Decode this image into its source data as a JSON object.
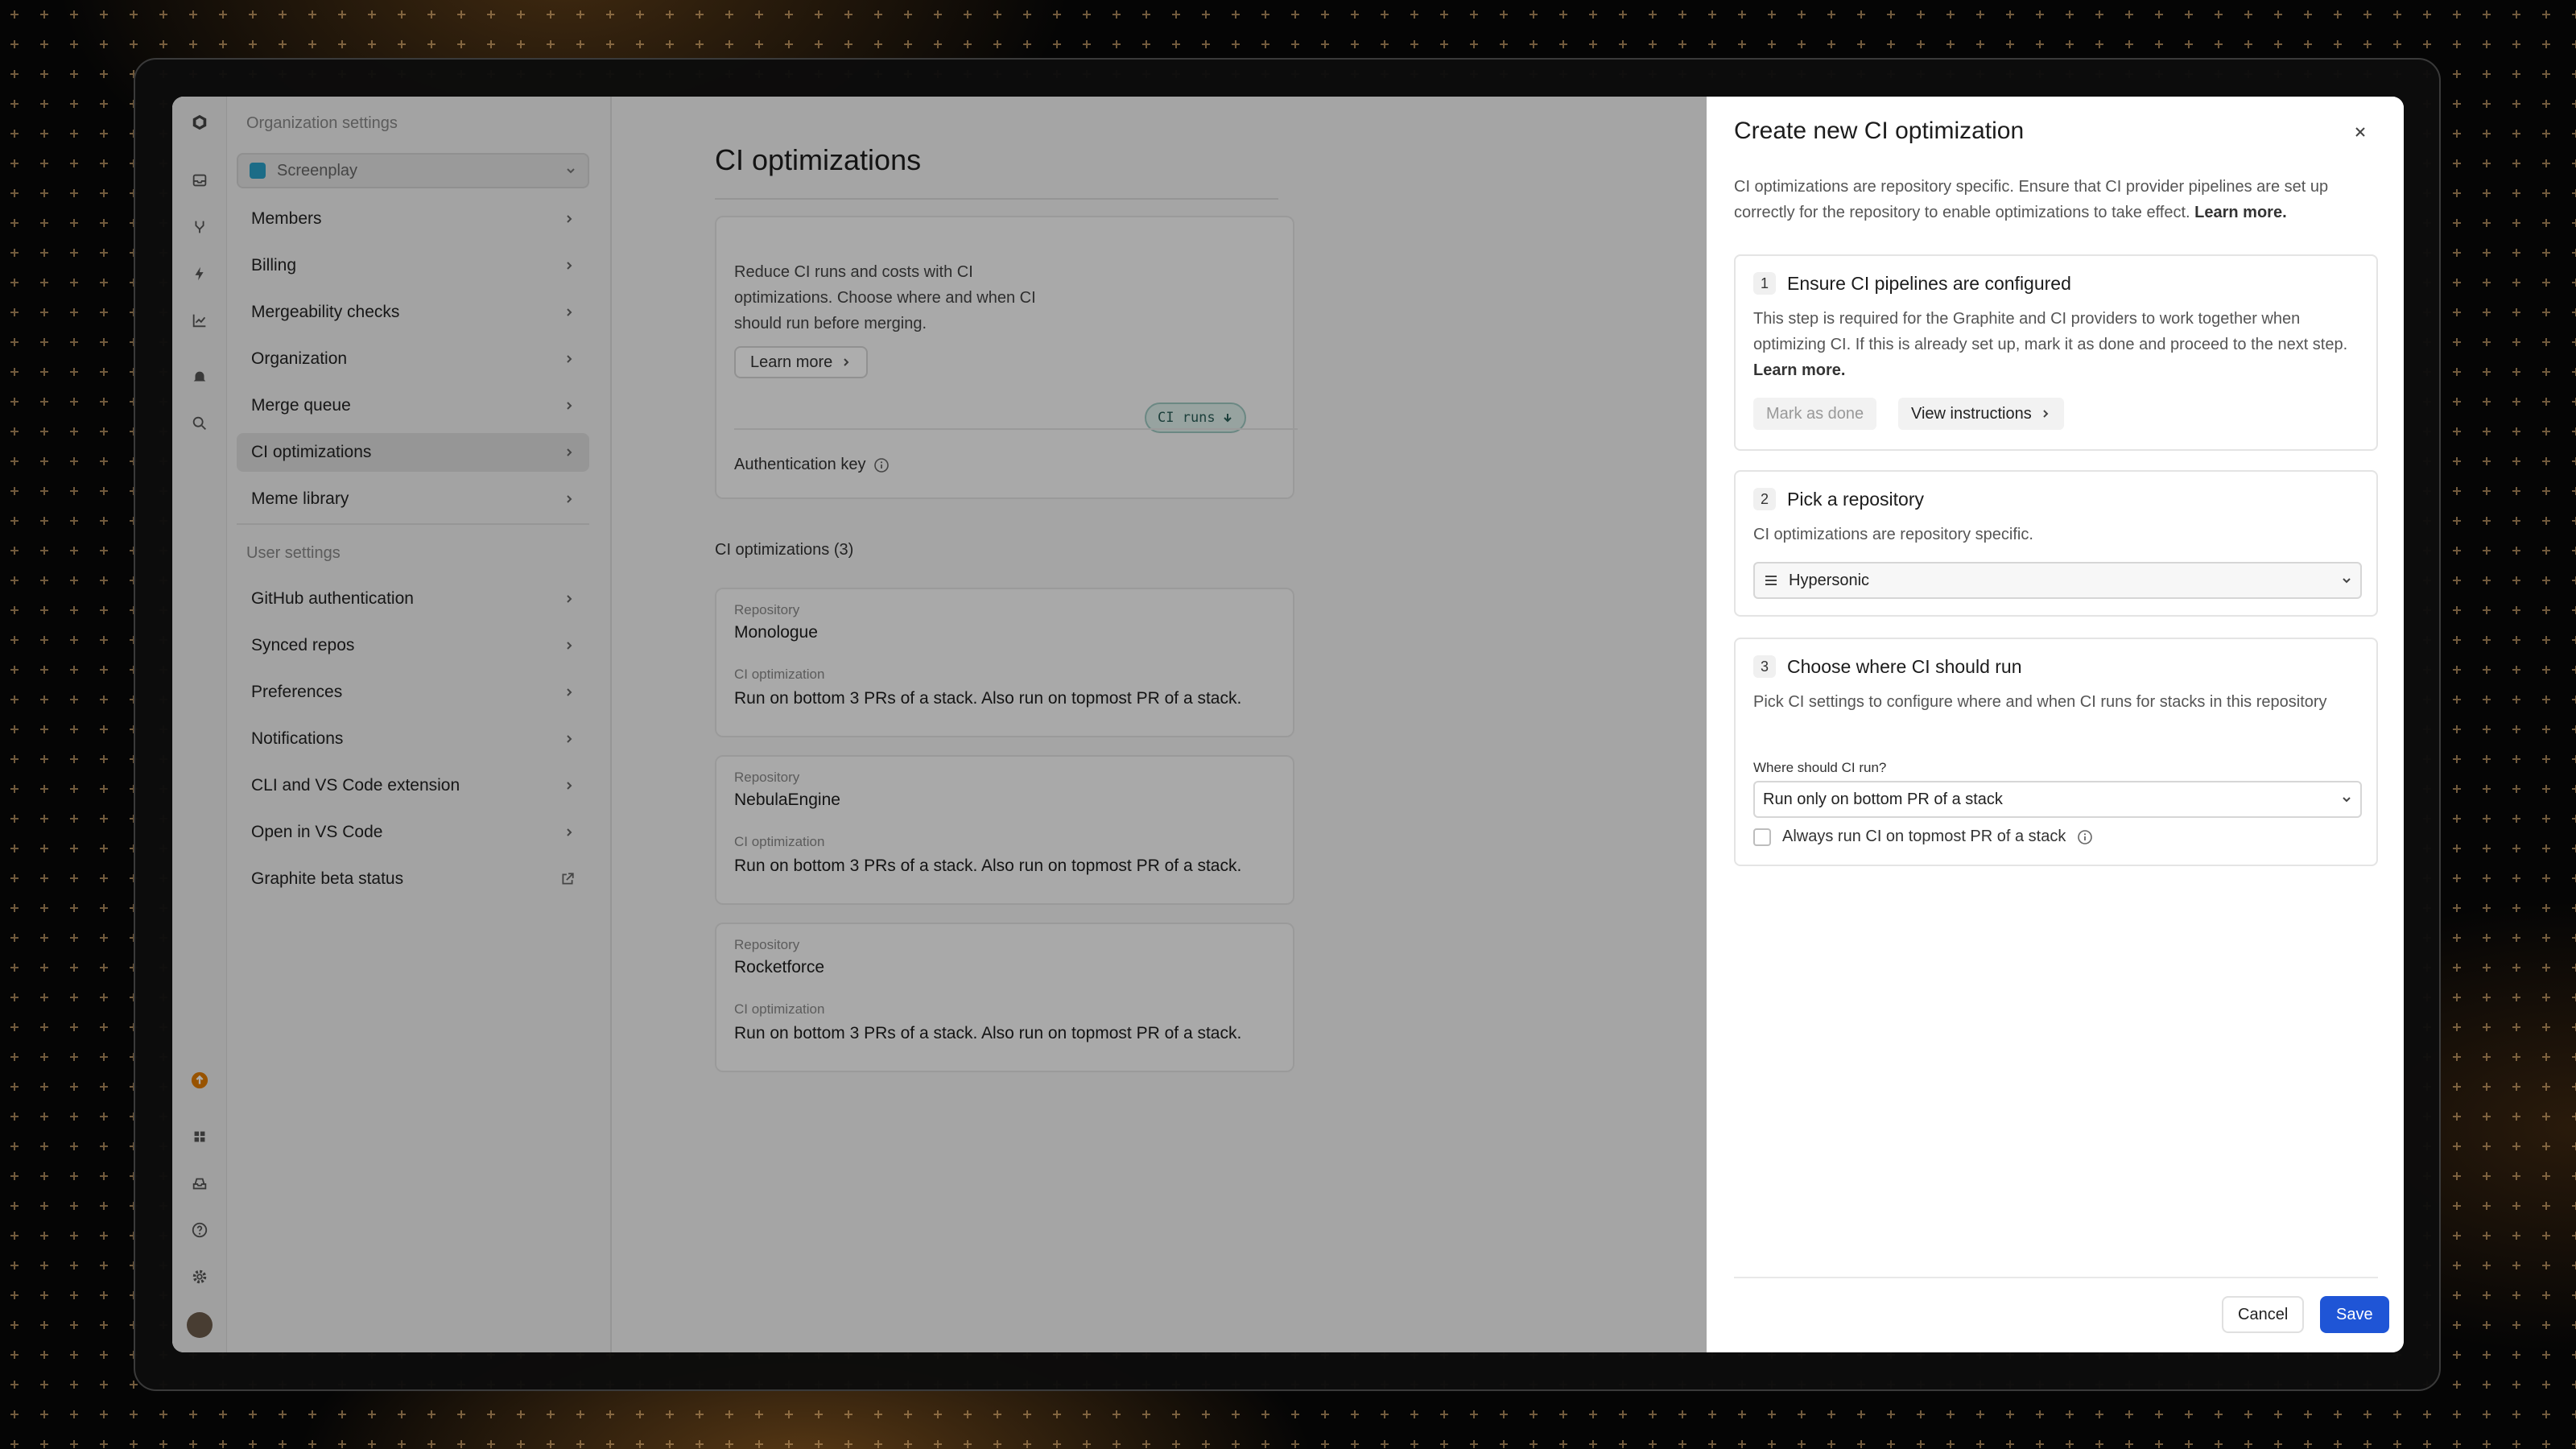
{
  "settings": {
    "org_section_title": "Organization settings",
    "org_selected": "Screenplay",
    "org_items": [
      {
        "label": "Members"
      },
      {
        "label": "Billing"
      },
      {
        "label": "Mergeability checks"
      },
      {
        "label": "Organization"
      },
      {
        "label": "Merge queue"
      },
      {
        "label": "CI optimizations"
      },
      {
        "label": "Meme library"
      }
    ],
    "user_section_title": "User settings",
    "user_items": [
      {
        "label": "GitHub authentication"
      },
      {
        "label": "Synced repos"
      },
      {
        "label": "Preferences"
      },
      {
        "label": "Notifications"
      },
      {
        "label": "CLI and VS Code extension"
      },
      {
        "label": "Open in VS Code"
      },
      {
        "label": "Graphite beta status"
      }
    ]
  },
  "main": {
    "title": "CI optimizations",
    "promo_text": "Reduce CI runs and costs with CI optimizations. Choose where and when CI should run before  merging.",
    "learn_more": "Learn more",
    "chip": "CI runs",
    "auth_key_label": "Authentication key",
    "list_title": "CI optimizations (3)",
    "repo_label": "Repository",
    "opt_label": "CI optimization",
    "repos": [
      {
        "name": "Monologue",
        "opt": "Run on bottom 3 PRs of a stack. Also run on topmost PR of a stack."
      },
      {
        "name": "NebulaEngine",
        "opt": "Run on bottom 3 PRs of a stack. Also run on topmost PR of a stack."
      },
      {
        "name": "Rocketforce",
        "opt": "Run on bottom 3 PRs of a stack. Also run on topmost PR of a stack."
      }
    ]
  },
  "drawer": {
    "title": "Create new CI optimization",
    "intro": "CI optimizations are repository specific. Ensure that CI provider pipelines are set up correctly for the repository to enable optimizations to take effect.",
    "intro_link": "Learn more.",
    "step1": {
      "num": "1",
      "title": "Ensure CI pipelines are configured",
      "desc": "This step is required for the Graphite and CI providers to work together when optimizing CI. If this is already set up, mark it as done and proceed to the next step.",
      "desc_link": "Learn more.",
      "mark_done": "Mark as done",
      "view_instructions": "View instructions"
    },
    "step2": {
      "num": "2",
      "title": "Pick a repository",
      "desc": "CI optimizations are repository specific.",
      "selected_repo": "Hypersonic"
    },
    "step3": {
      "num": "3",
      "title": "Choose where CI should run",
      "desc": "Pick CI settings to configure where and when CI runs for stacks in this repository",
      "field_label": "Where should CI run?",
      "selected_option": "Run only on bottom PR of a stack",
      "checkbox_label": "Always run CI on topmost PR of a stack",
      "checkbox_checked": false
    },
    "cancel": "Cancel",
    "save": "Save"
  },
  "colors": {
    "accent": "#1f55d6",
    "chip_bg": "#dff0ec",
    "notification": "#e07b00"
  }
}
